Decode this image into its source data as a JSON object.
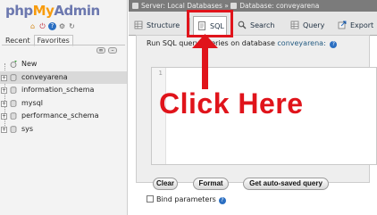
{
  "nav": {
    "logo": {
      "php": "php",
      "my": "My",
      "admin": "Admin"
    },
    "tabs": {
      "recent": "Recent",
      "favorites": "Favorites"
    },
    "icons": [
      "home-icon",
      "logout-icon",
      "help-icon",
      "settings-icon",
      "reload-icon"
    ],
    "tree": [
      {
        "label": "New",
        "icon": "new-db-icon",
        "expandable": false,
        "selected": false
      },
      {
        "label": "conveyarena",
        "icon": "database-icon",
        "expandable": true,
        "selected": true
      },
      {
        "label": "information_schema",
        "icon": "database-icon",
        "expandable": true,
        "selected": false
      },
      {
        "label": "mysql",
        "icon": "database-icon",
        "expandable": true,
        "selected": false
      },
      {
        "label": "performance_schema",
        "icon": "database-icon",
        "expandable": true,
        "selected": false
      },
      {
        "label": "sys",
        "icon": "database-icon",
        "expandable": true,
        "selected": false
      }
    ]
  },
  "breadcrumb": {
    "server": "Server: Local Databases",
    "separator": "»",
    "database": "Database: conveyarena"
  },
  "tabs": {
    "structure": "Structure",
    "sql": "SQL",
    "search": "Search",
    "query": "Query",
    "export": "Export",
    "active": "sql"
  },
  "sql_panel": {
    "heading_prefix": "Run SQL query/queries on database",
    "database": "conveyarena:",
    "line_number": "1"
  },
  "buttons": {
    "clear": "Clear",
    "format": "Format",
    "autosaved": "Get auto-saved query"
  },
  "bind_parameters": {
    "label": "Bind parameters",
    "checked": false
  },
  "annotation": {
    "text": "Click Here",
    "color": "#e0141b"
  },
  "colors": {
    "accent": "#235a81",
    "logo_blue": "#6c78af",
    "logo_orange": "#f89c0e",
    "breadcrumb_bg": "#7b7b7b"
  }
}
